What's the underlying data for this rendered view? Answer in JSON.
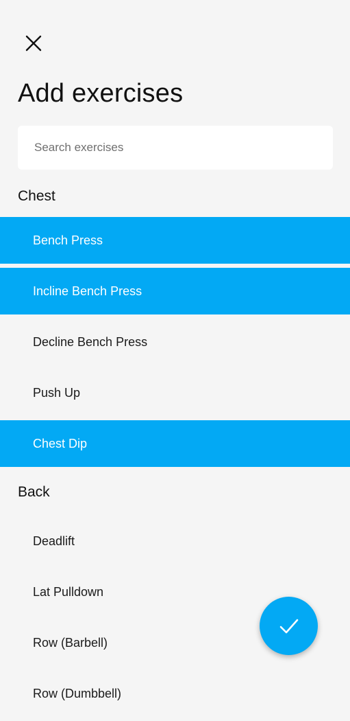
{
  "header": {
    "close_icon": "close-icon",
    "title": "Add exercises"
  },
  "search": {
    "placeholder": "Search exercises",
    "value": ""
  },
  "sections": [
    {
      "title": "Chest",
      "items": [
        {
          "label": "Bench Press",
          "selected": true
        },
        {
          "label": "Incline Bench Press",
          "selected": true
        },
        {
          "label": "Decline Bench Press",
          "selected": false
        },
        {
          "label": "Push Up",
          "selected": false
        },
        {
          "label": "Chest Dip",
          "selected": true
        }
      ]
    },
    {
      "title": "Back",
      "items": [
        {
          "label": "Deadlift",
          "selected": false
        },
        {
          "label": "Lat Pulldown",
          "selected": false
        },
        {
          "label": "Row (Barbell)",
          "selected": false
        },
        {
          "label": "Row (Dumbbell)",
          "selected": false
        }
      ]
    }
  ],
  "fab": {
    "icon": "check-icon"
  },
  "colors": {
    "accent": "#03a9f4",
    "background": "#f5f5f5",
    "selected_text": "#ffffff"
  }
}
